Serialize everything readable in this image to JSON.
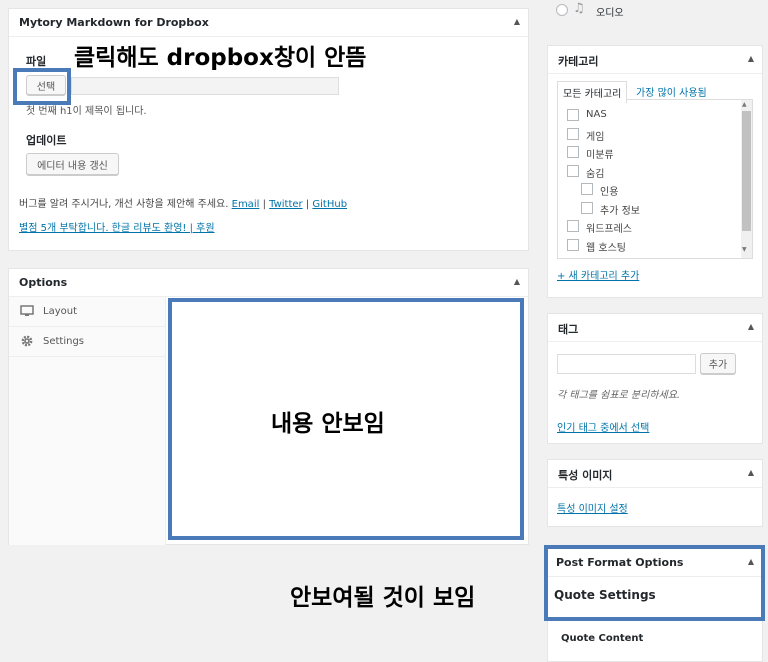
{
  "markdown_box": {
    "title": "Mytory Markdown for Dropbox",
    "file_label": "파일",
    "select_button": "선택",
    "hint": "첫 번째 h1이 제목이 됩니다.",
    "update_label": "업데이트",
    "refresh_button": "에디터 내용 갱신",
    "bug_text": "버그를 알려 주시거나, 개선 사항을 제안해 주세요.",
    "email_link": "Email",
    "twitter_link": "Twitter",
    "github_link": "GitHub",
    "sep": "|",
    "review_text": "별점 5개 부탁합니다. 한글 리뷰도 환영! | 후원"
  },
  "options_box": {
    "title": "Options",
    "tabs": [
      {
        "label": "Layout",
        "icon": "monitor-icon"
      },
      {
        "label": "Settings",
        "icon": "gear-icon"
      }
    ]
  },
  "annotations": {
    "dropbox_note": "클릭해도 dropbox창이 안뜸",
    "content_note": "내용 안보임",
    "shown_note": "안보여될 것이 보임"
  },
  "format_audio": {
    "label": "오디오"
  },
  "category_box": {
    "title": "카테고리",
    "tab_all": "모든 카테고리",
    "tab_popular": "가장 많이 사용됨",
    "items": [
      {
        "label": "NAS",
        "indent": false
      },
      {
        "label": "게임",
        "indent": false
      },
      {
        "label": "미분류",
        "indent": false
      },
      {
        "label": "숨김",
        "indent": false
      },
      {
        "label": "인용",
        "indent": true
      },
      {
        "label": "추가 정보",
        "indent": true
      },
      {
        "label": "워드프레스",
        "indent": false
      },
      {
        "label": "웹 호스팅",
        "indent": false
      }
    ],
    "add_link": "+ 새 카테고리 추가"
  },
  "tag_box": {
    "title": "태그",
    "add_button": "추가",
    "hint": "각 태그를 쉼표로 분리하세요.",
    "popular_link": "인기 태그 중에서 선택"
  },
  "featured_box": {
    "title": "특성 이미지",
    "set_link": "특성 이미지 설정"
  },
  "post_format_box": {
    "title": "Post Format Options",
    "quote_settings": "Quote Settings",
    "quote_content": "Quote Content"
  },
  "colors": {
    "accent": "#0073aa",
    "frame": "#4a7bb8"
  }
}
